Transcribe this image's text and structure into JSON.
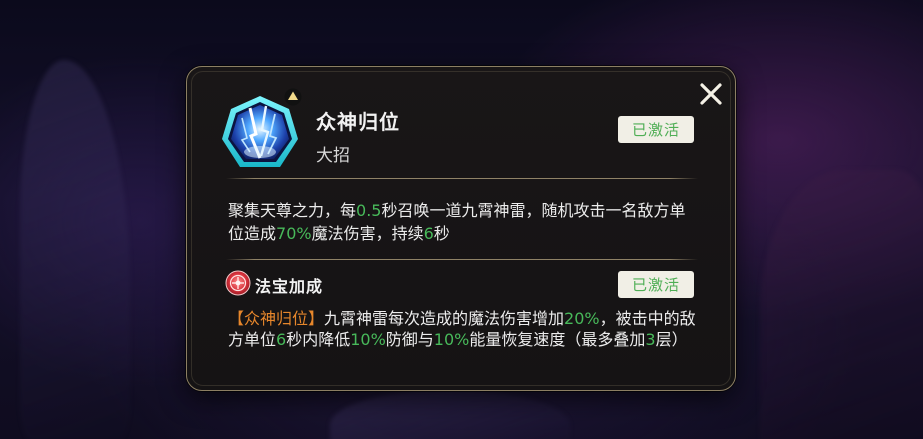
{
  "skill": {
    "name": "众神归位",
    "type": "大招",
    "status": "已激活",
    "icon": "lightning-skill-icon",
    "description": {
      "seg1": "聚集天尊之力，每",
      "v1": "0.5",
      "seg2": "秒召唤一道九霄神雷，随机攻击一名敌方单位造成",
      "v2": "70%",
      "seg3": "魔法伤害，持续",
      "v3": "6",
      "seg4": "秒"
    }
  },
  "treasure": {
    "title": "法宝加成",
    "status": "已激活",
    "icon": "treasure-seal-icon",
    "description": {
      "tag": "【众神归位】",
      "seg1": "九霄神雷每次造成的魔法伤害增加",
      "v1": "20%",
      "seg2": "，被击中的敌方单位",
      "v2": "6",
      "seg3": "秒内降低",
      "v3": "10%",
      "seg4": "防御与",
      "v4": "10%",
      "seg5": "能量恢复速度（最多叠加",
      "v5": "3",
      "seg6": "层）"
    }
  },
  "colors": {
    "highlight_green": "#48b95a",
    "tag_orange": "#e7872b",
    "panel_border": "#8c7f63",
    "badge_text": "#4fae55"
  }
}
